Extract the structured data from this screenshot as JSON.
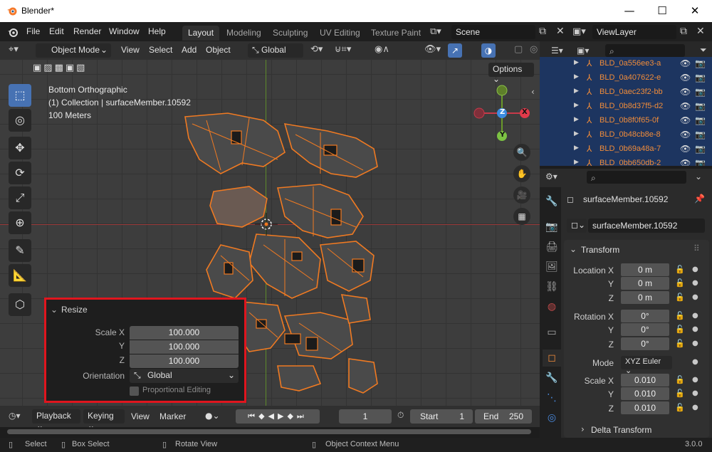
{
  "window": {
    "title": "Blender*",
    "minimize": "—",
    "maximize": "☐",
    "close": "✕"
  },
  "menu": [
    "File",
    "Edit",
    "Render",
    "Window",
    "Help"
  ],
  "workspaces": [
    "Layout",
    "Modeling",
    "Sculpting",
    "UV Editing",
    "Texture Paint"
  ],
  "scene": {
    "label": "Scene",
    "view_layer": "ViewLayer"
  },
  "viewport_header": {
    "mode": "Object Mode",
    "view": "View",
    "select": "Select",
    "add": "Add",
    "object": "Object",
    "orientation": "Global",
    "options": "Options"
  },
  "viewport_info": {
    "line1": "Bottom Orthographic",
    "line2": "(1) Collection | surfaceMember.10592",
    "line3": "100 Meters"
  },
  "gizmo": {
    "x": "X",
    "y": "Y",
    "z": "Z"
  },
  "resize_panel": {
    "title": "Resize",
    "scale_x_label": "Scale X",
    "scale_y_label": "Y",
    "scale_z_label": "Z",
    "scale_x": "100.000",
    "scale_y": "100.000",
    "scale_z": "100.000",
    "orientation_label": "Orientation",
    "orientation": "Global",
    "proportional": "Proportional Editing"
  },
  "timeline": {
    "playback": "Playback",
    "keying": "Keying",
    "view": "View",
    "marker": "Marker",
    "frame": "1",
    "start_label": "Start",
    "start": "1",
    "end_label": "End",
    "end": "250"
  },
  "status": {
    "select": "Select",
    "box_select": "Box Select",
    "rotate_view": "Rotate View",
    "context_menu": "Object Context Menu",
    "version": "3.0.0"
  },
  "outliner": {
    "items": [
      "BLD_0a556ee3-a",
      "BLD_0a407622-e",
      "BLD_0aec23f2-bb",
      "BLD_0b8d37f5-d2",
      "BLD_0b8f0f65-0f",
      "BLD_0b48cb8e-8",
      "BLD_0b69a48a-7",
      "BLD_0bb650db-2"
    ]
  },
  "properties": {
    "object_name": "surfaceMember.10592",
    "data_name": "surfaceMember.10592",
    "transform": "Transform",
    "location_label": "Location X",
    "location": [
      "0 m",
      "0 m",
      "0 m"
    ],
    "rotation_label": "Rotation X",
    "rotation": [
      "0°",
      "0°",
      "0°"
    ],
    "mode_label": "Mode",
    "mode": "XYZ Euler",
    "scale_label": "Scale X",
    "scale": [
      "0.010",
      "0.010",
      "0.010"
    ],
    "y_label": "Y",
    "z_label": "Z",
    "delta": "Delta Transform"
  },
  "colors": {
    "accent": "#4772b3",
    "selection": "#f08c3a",
    "highlight_box": "#e0151e"
  }
}
